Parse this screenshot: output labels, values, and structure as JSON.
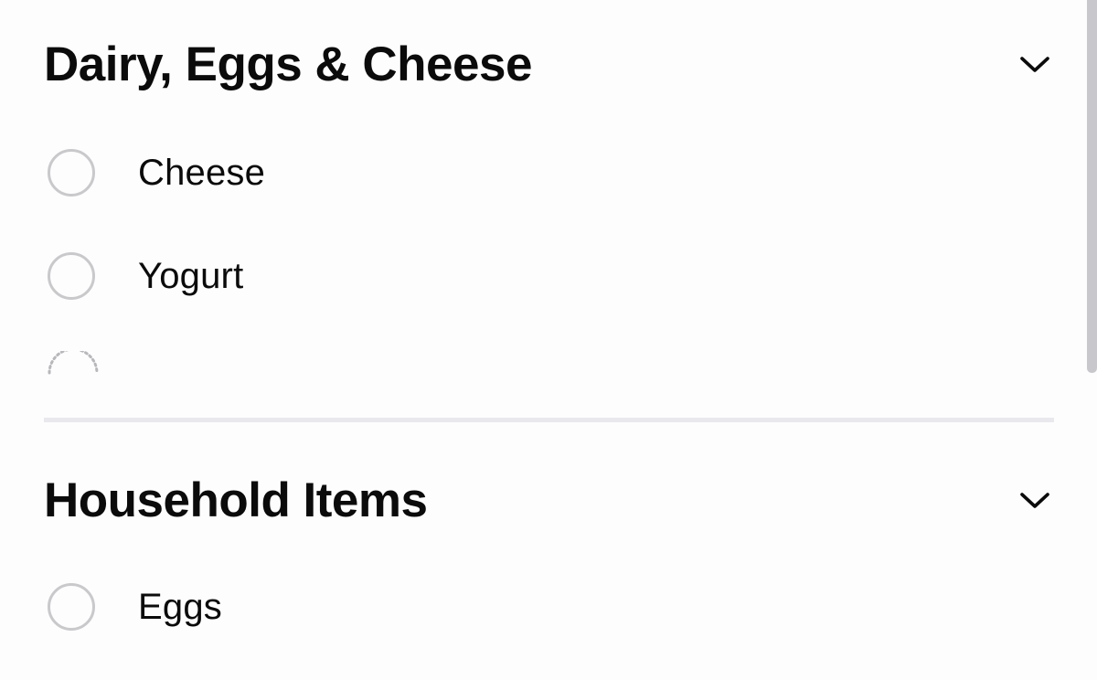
{
  "sections": [
    {
      "title": "Dairy, Eggs & Cheese",
      "items": [
        {
          "label": "Cheese"
        },
        {
          "label": "Yogurt"
        }
      ]
    },
    {
      "title": "Household Items",
      "items": [
        {
          "label": "Eggs"
        }
      ]
    }
  ],
  "icons": {
    "collapse": "chevron-down-icon",
    "loading": "loading-spinner-icon",
    "checkbox": "radio-circle-icon"
  },
  "colors": {
    "background": "#fdfdfe",
    "text": "#0b0b0b",
    "radio_border": "#c9c9cc",
    "divider": "#e8e8ed",
    "scrollbar": "#c8c8cc"
  }
}
